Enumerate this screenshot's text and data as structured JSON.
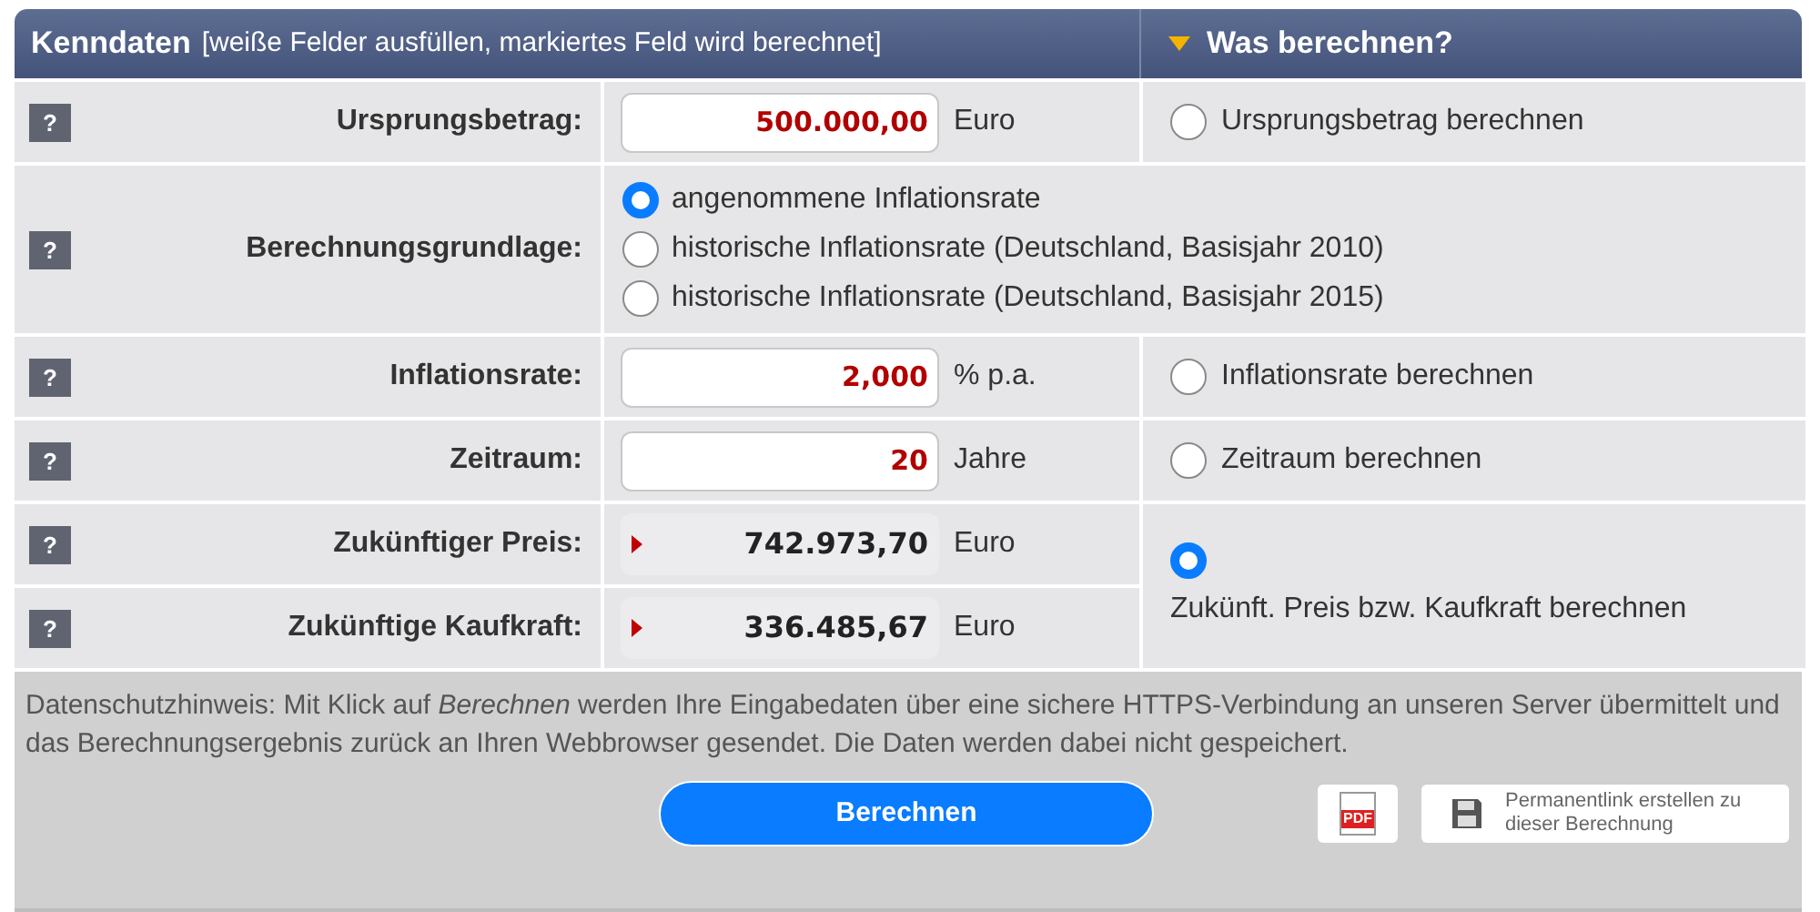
{
  "header": {
    "title": "Kenndaten",
    "subtitle": "[weiße Felder ausfüllen, markiertes Feld wird berechnet]",
    "right_title": "Was berechnen?"
  },
  "rows": [
    {
      "kind": "field",
      "label": "Ursprungsbetrag:",
      "value": "500.000,00",
      "unit": "Euro",
      "target": {
        "label": "Ursprungsbetrag berechnen",
        "selected": false
      }
    },
    {
      "kind": "choice",
      "label": "Berechnungsgrundlage:",
      "options": [
        {
          "label": "angenommene Inflationsrate",
          "selected": true
        },
        {
          "label": "historische Inflationsrate (Deutschland, Basisjahr 2010)",
          "selected": false
        },
        {
          "label": "historische Inflationsrate (Deutschland, Basisjahr 2015)",
          "selected": false
        }
      ]
    },
    {
      "kind": "field",
      "label": "Inflationsrate:",
      "value": "2,000",
      "unit": "% p.a.",
      "target": {
        "label": "Inflationsrate berechnen",
        "selected": false
      }
    },
    {
      "kind": "field",
      "label": "Zeitraum:",
      "value": "20",
      "unit": "Jahre",
      "target": {
        "label": "Zeitraum berechnen",
        "selected": false
      }
    },
    {
      "kind": "result",
      "label": "Zukünftiger Preis:",
      "value": "742.973,70",
      "unit": "Euro",
      "target": {
        "label": "Zukünft. Preis bzw. Kaufkraft berechnen",
        "selected": true
      }
    },
    {
      "kind": "result",
      "label": "Zukünftige Kaufkraft:",
      "value": "336.485,67",
      "unit": "Euro"
    }
  ],
  "help_label": "?",
  "privacy_note": "Datenschutzhinweis: Mit Klick auf *Berechnen* werden Ihre Eingabedaten über eine sichere HTTPS-Verbindung an unseren Server übermittelt und das Berechnungsergebnis zurück an Ihren Webbrowser gesendet. Die Daten werden dabei nicht gespeichert.",
  "calculate_button": "Berechnen",
  "pdf_label": "PDF",
  "permalink_button": "Permanentlink erstellen zu dieser Berechnung"
}
